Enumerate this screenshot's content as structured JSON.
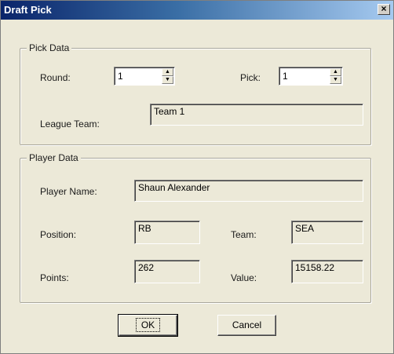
{
  "window": {
    "title": "Draft Pick",
    "close_label": "×"
  },
  "pick_data": {
    "group_label": "Pick Data",
    "round": {
      "label": "Round:",
      "value": "1"
    },
    "pick": {
      "label": "Pick:",
      "value": "1"
    },
    "league_team": {
      "label": "League Team:",
      "value": "Team 1"
    }
  },
  "player_data": {
    "group_label": "Player Data",
    "player_name": {
      "label": "Player Name:",
      "value": "Shaun Alexander"
    },
    "position": {
      "label": "Position:",
      "value": "RB"
    },
    "team": {
      "label": "Team:",
      "value": "SEA"
    },
    "points": {
      "label": "Points:",
      "value": "262"
    },
    "value": {
      "label": "Value:",
      "value": "15158.22"
    }
  },
  "buttons": {
    "ok": "OK",
    "cancel": "Cancel"
  }
}
